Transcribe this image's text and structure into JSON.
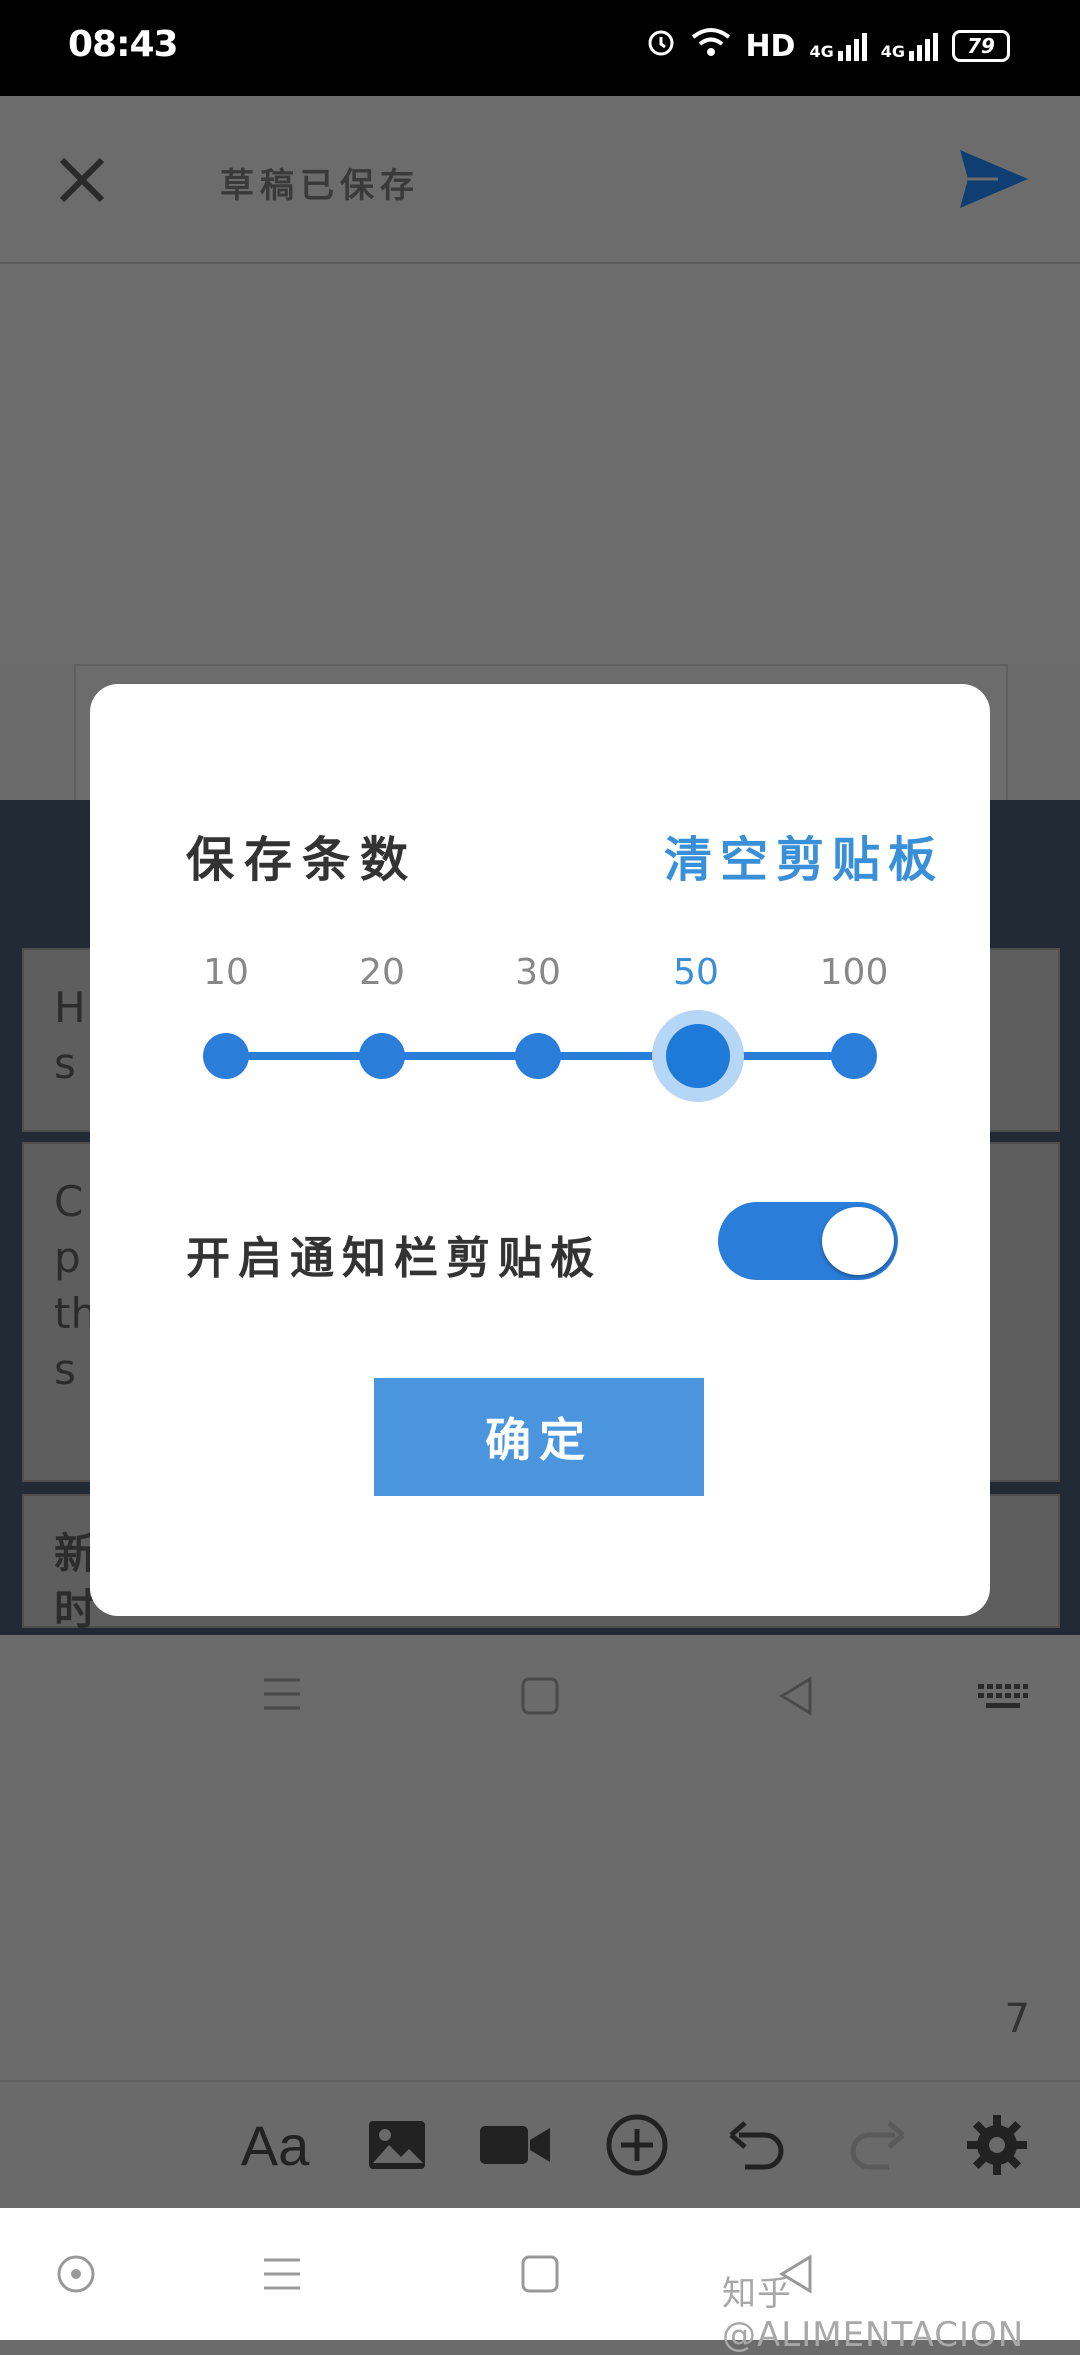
{
  "status_bar": {
    "time": "08:43",
    "network_label": "HD",
    "net_1": "4G",
    "net_2": "4G",
    "battery": "79"
  },
  "editor": {
    "draft_status": "草稿已保存",
    "word_count": "7"
  },
  "clipboard_cards": [
    {
      "peek": "H\ns"
    },
    {
      "peek": "C\np\nth\ns"
    },
    {
      "peek": "新\n时"
    }
  ],
  "toolbar": {
    "font_label": "Aa"
  },
  "dialog": {
    "save_count_label": "保存条数",
    "clear_clipboard": "清空剪贴板",
    "slider_options": [
      "10",
      "20",
      "30",
      "50",
      "100"
    ],
    "selected_value": "50",
    "notification_label": "开启通知栏剪贴板",
    "notification_enabled": true,
    "confirm": "确定"
  },
  "watermark": "知乎 @ALIMENTACION",
  "colors": {
    "accent": "#2a7dd9",
    "button": "#4a95dd",
    "clear_text": "#3a8fd9"
  }
}
